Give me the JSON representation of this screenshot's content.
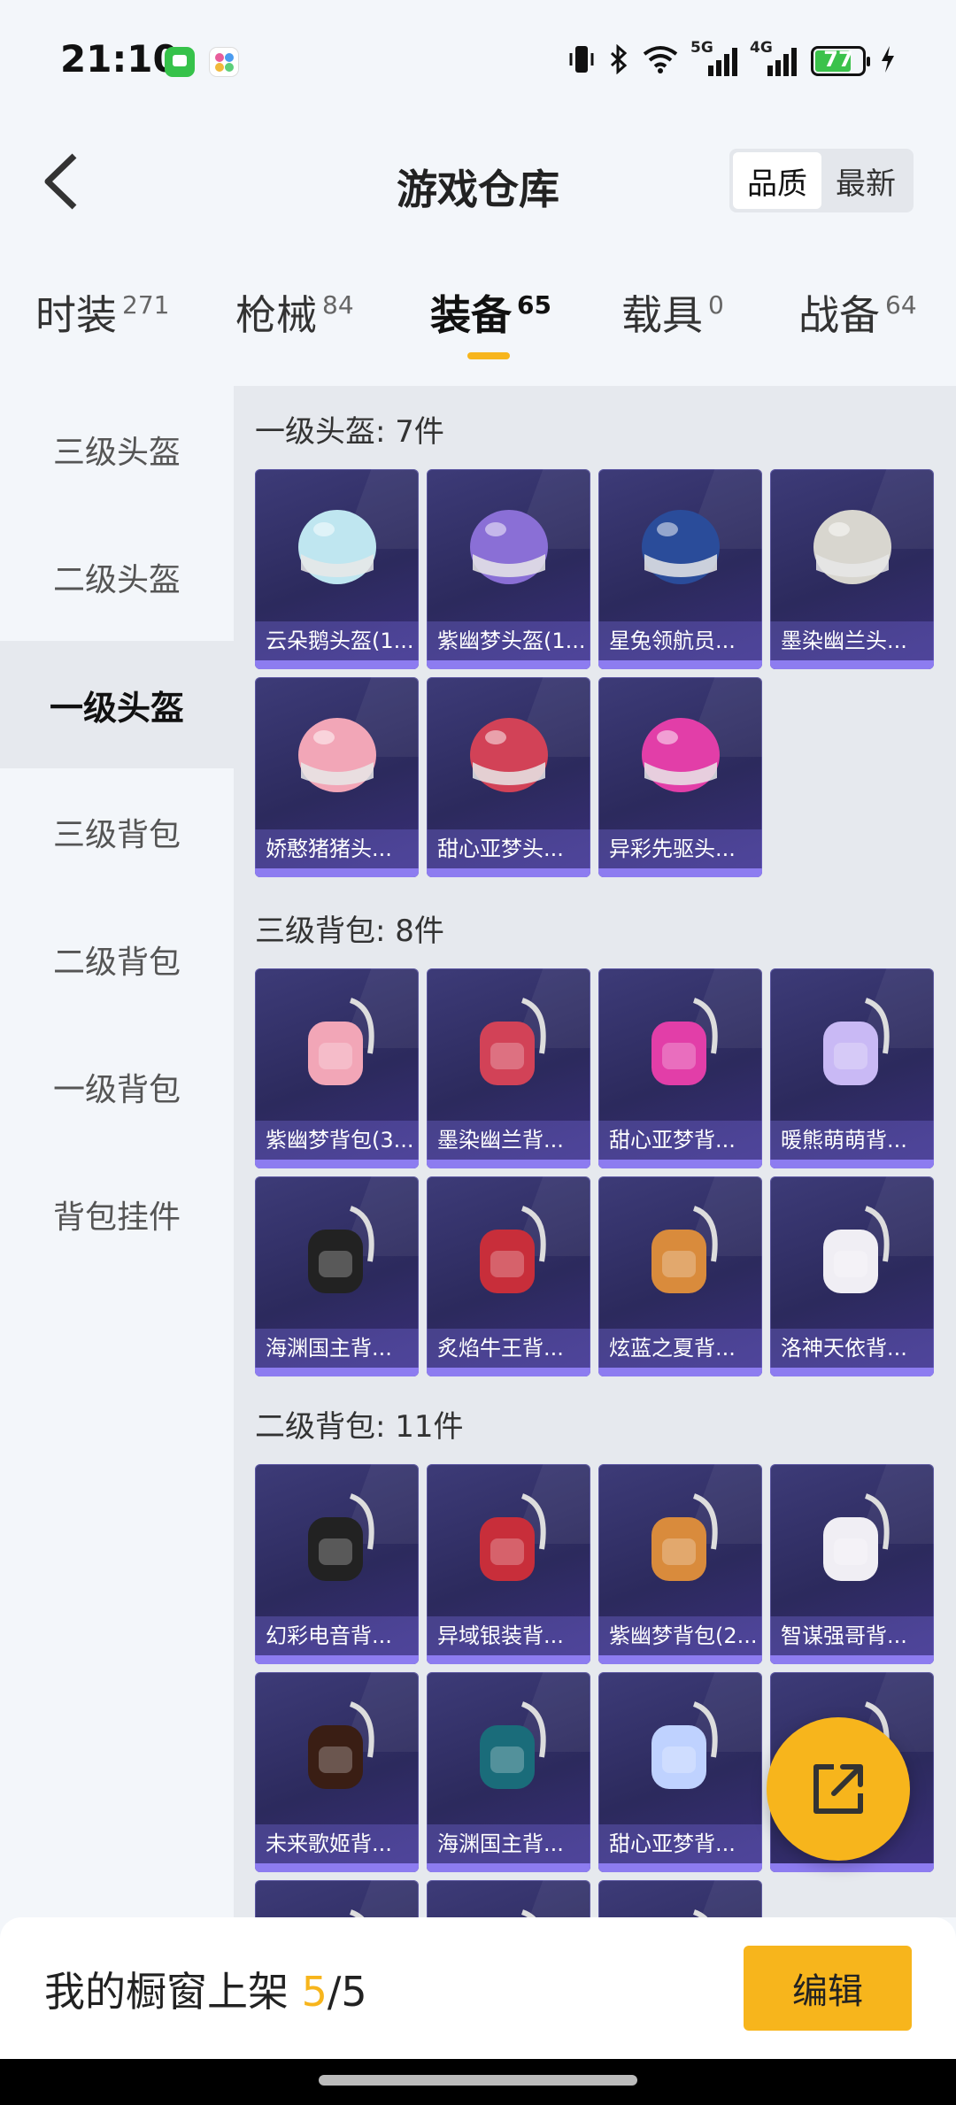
{
  "status_bar": {
    "time": "21:10",
    "battery": "77",
    "net1": "5G",
    "net2": "4G"
  },
  "header": {
    "title": "游戏仓库",
    "sort_options": [
      "品质",
      "最新"
    ],
    "sort_selected": "品质"
  },
  "tabs": [
    {
      "label": "时装",
      "count": "271"
    },
    {
      "label": "枪械",
      "count": "84"
    },
    {
      "label": "装备",
      "count": "65",
      "active": true
    },
    {
      "label": "载具",
      "count": "0"
    },
    {
      "label": "战备",
      "count": "64"
    }
  ],
  "sidebar": {
    "items": [
      {
        "label": "三级头盔"
      },
      {
        "label": "二级头盔"
      },
      {
        "label": "一级头盔",
        "active": true
      },
      {
        "label": "三级背包"
      },
      {
        "label": "二级背包"
      },
      {
        "label": "一级背包"
      },
      {
        "label": "背包挂件"
      }
    ]
  },
  "sections": [
    {
      "title": "一级头盔: 7件",
      "items": [
        "云朵鹅头盔(1...",
        "紫幽梦头盔(1...",
        "星兔领航员...",
        "墨染幽兰头...",
        "娇憨猪猪头...",
        "甜心亚梦头...",
        "异彩先驱头..."
      ]
    },
    {
      "title": "三级背包: 8件",
      "items": [
        "紫幽梦背包(3...",
        "墨染幽兰背...",
        "甜心亚梦背...",
        "暖熊萌萌背...",
        "海渊国主背...",
        "炙焰牛王背...",
        "炫蓝之夏背...",
        "洛神天依背..."
      ]
    },
    {
      "title": "二级背包: 11件",
      "items": [
        "幻彩电音背...",
        "异域银装背...",
        "紫幽梦背包(2...",
        "智谋强哥背...",
        "未来歌姬背...",
        "海渊国主背...",
        "甜心亚梦背...",
        "",
        "",
        "",
        ""
      ]
    }
  ],
  "bottom_bar": {
    "label": "我的橱窗上架",
    "shown": "5",
    "total": "/5",
    "edit_button": "编辑"
  },
  "colors": {
    "accent": "#f7b51c",
    "card_bg": "#2c2a5d",
    "card_bar": "#8d7cf0"
  },
  "icons": {
    "back": "chevron-left-icon",
    "share": "share-icon"
  }
}
